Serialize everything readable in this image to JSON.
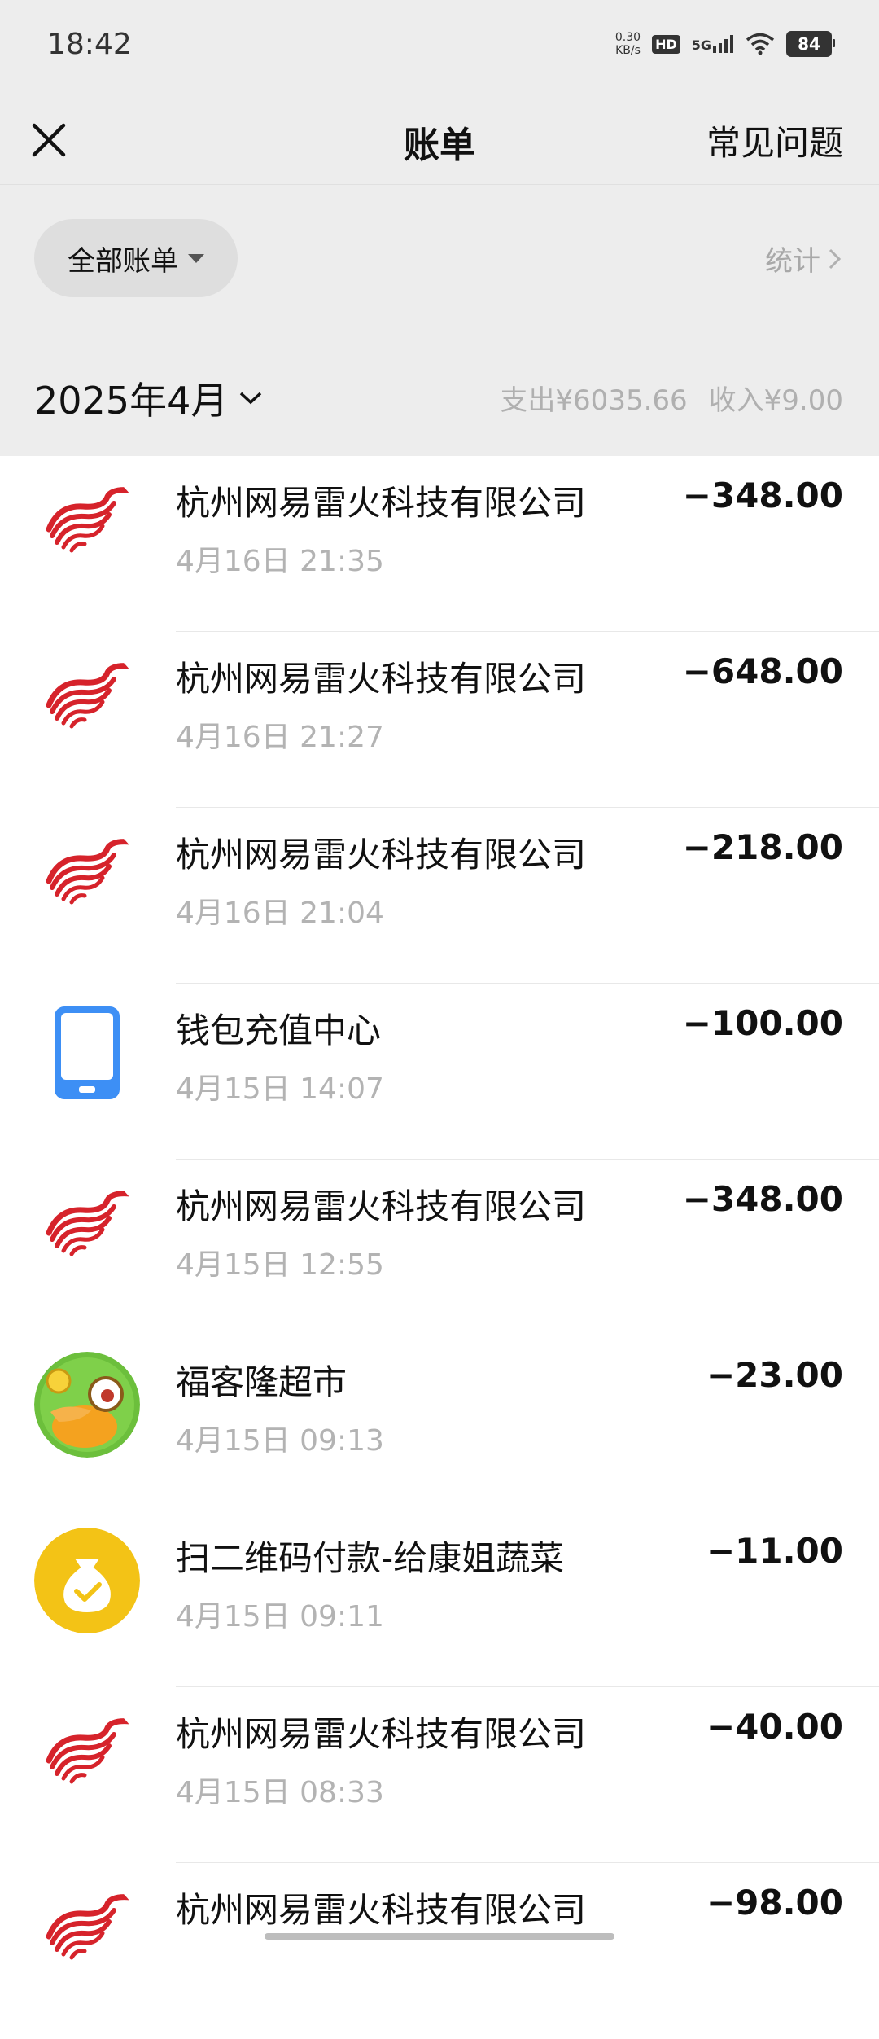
{
  "status_bar": {
    "time": "18:42",
    "net_speed_value": "0.30",
    "net_speed_unit": "KB/s",
    "hd_label": "HD",
    "network": "5G",
    "battery": "84"
  },
  "nav": {
    "title": "账单",
    "faq_label": "常见问题",
    "close_icon": "close-icon"
  },
  "filter": {
    "label": "全部账单",
    "stats_label": "统计"
  },
  "month": {
    "label": "2025年4月",
    "expense": "支出¥6035.66",
    "income": "收入¥9.00"
  },
  "transactions": [
    {
      "name": "杭州网易雷火科技有限公司",
      "time": "4月16日 21:35",
      "amount": "−348.00",
      "icon": "netease-logo-icon"
    },
    {
      "name": "杭州网易雷火科技有限公司",
      "time": "4月16日 21:27",
      "amount": "−648.00",
      "icon": "netease-logo-icon"
    },
    {
      "name": "杭州网易雷火科技有限公司",
      "time": "4月16日 21:04",
      "amount": "−218.00",
      "icon": "netease-logo-icon"
    },
    {
      "name": "钱包充值中心",
      "time": "4月15日 14:07",
      "amount": "−100.00",
      "icon": "phone-icon"
    },
    {
      "name": "杭州网易雷火科技有限公司",
      "time": "4月15日 12:55",
      "amount": "−348.00",
      "icon": "netease-logo-icon"
    },
    {
      "name": "福客隆超市",
      "time": "4月15日 09:13",
      "amount": "−23.00",
      "icon": "cartoon-bird-icon"
    },
    {
      "name": "扫二维码付款-给康姐蔬菜",
      "time": "4月15日 09:11",
      "amount": "−11.00",
      "icon": "money-bag-icon"
    },
    {
      "name": "杭州网易雷火科技有限公司",
      "time": "4月15日 08:33",
      "amount": "−40.00",
      "icon": "netease-logo-icon"
    },
    {
      "name": "杭州网易雷火科技有限公司",
      "time": "",
      "amount": "−98.00",
      "icon": "netease-logo-icon"
    }
  ],
  "colors": {
    "header_bg": "#ededed",
    "netease_red": "#d6232b",
    "phone_blue": "#3d8ff5",
    "bag_yellow": "#f3c316",
    "muted_text": "#b3b3b3"
  }
}
